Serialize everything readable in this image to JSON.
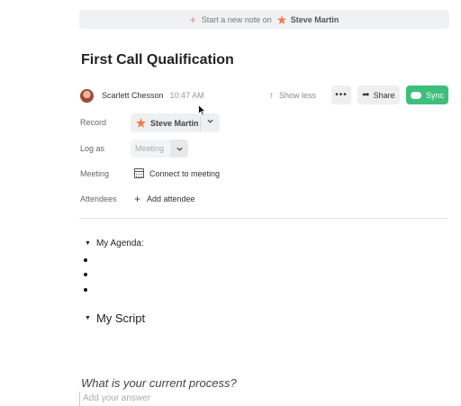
{
  "new_note_bar": {
    "prefix": "Start a new note on",
    "contact": "Steve Martin"
  },
  "note": {
    "title": "First Call Qualification",
    "author": "Scarlett Chesson",
    "time": "10:47 AM"
  },
  "toolbar": {
    "show_less": "Show less",
    "more": "•••",
    "share": "Share",
    "sync": "Sync"
  },
  "fields": {
    "record_label": "Record",
    "record_value": "Steve Martin",
    "logas_label": "Log as",
    "logas_value": "Meeting",
    "meeting_label": "Meeting",
    "meeting_value": "Connect to meeting",
    "attendees_label": "Attendees",
    "attendees_value": "Add attendee"
  },
  "body": {
    "agenda_heading": "My Agenda:",
    "agenda_bullets": [
      "",
      "",
      ""
    ],
    "script_heading": "My Script",
    "question": "What is your current process?",
    "answer_placeholder": "Add your answer"
  },
  "colors": {
    "accent_green": "#3cbf7a",
    "star_orange": "#f07a4d",
    "plus_red": "#e87b74"
  }
}
